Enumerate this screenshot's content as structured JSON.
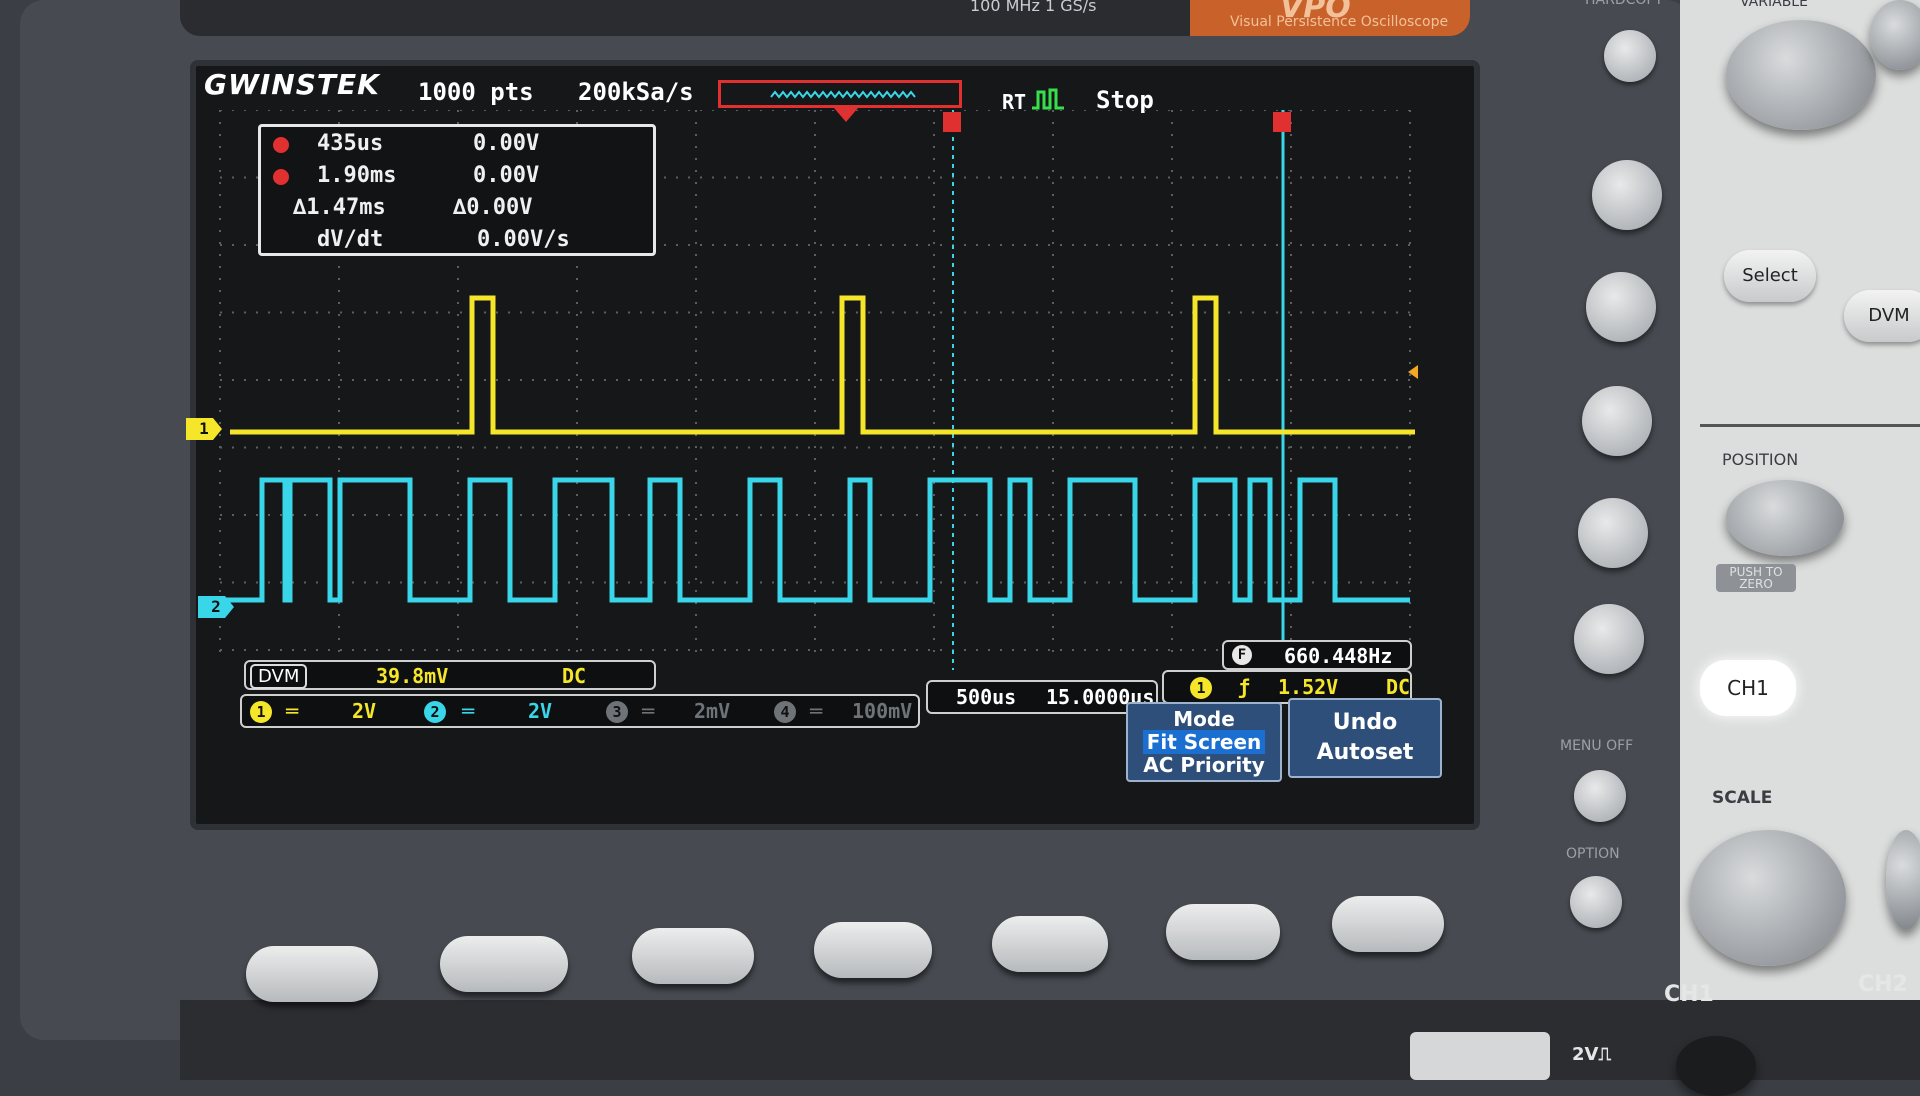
{
  "device_top": {
    "spec_text": "100 MHz  1 GS/s",
    "badge_text": "VPO",
    "subtitle": "Visual Persistence Oscilloscope",
    "hardcopy_label": "HARDCOPY",
    "variable_label": "VARIABLE"
  },
  "header": {
    "brand": "GWINSTEK",
    "record_length": "1000 pts",
    "sample_rate": "200kSa/s",
    "acq_mode": "RT",
    "run_state": "Stop"
  },
  "cursor_readout": {
    "c1_time": "435us",
    "c1_volt": "0.00V",
    "c2_time": "1.90ms",
    "c2_volt": "0.00V",
    "delta_time": "∆1.47ms",
    "delta_volt": "∆0.00V",
    "dvdt_label": "dV/dt",
    "dvdt_value": "0.00V/s",
    "c1_marker": "1",
    "c2_marker": "2"
  },
  "markers": {
    "ch1": "1",
    "ch2": "2"
  },
  "frequency": {
    "label": "F",
    "value": "660.448Hz"
  },
  "dvm": {
    "label": "DVM",
    "value": "39.8mV",
    "coupling": "DC"
  },
  "channels": [
    {
      "num": "1",
      "coupling_symbol": "═",
      "scale": "2V",
      "color": "#f5e62a"
    },
    {
      "num": "2",
      "coupling_symbol": "═",
      "scale": "2V",
      "color": "#39d5e8"
    },
    {
      "num": "3",
      "coupling_symbol": "═",
      "scale": "2mV",
      "color": "#6e7378"
    },
    {
      "num": "4",
      "coupling_symbol": "═",
      "scale": "100mV",
      "color": "#6e7378"
    }
  ],
  "timebase": {
    "scale": "500us",
    "position": "15.0000us"
  },
  "trigger": {
    "source": "1",
    "slope_symbol": "ƒ",
    "level": "1.52V",
    "coupling": "DC"
  },
  "softkey_menu": {
    "mode_title": "Mode",
    "mode_selected": "Fit Screen",
    "mode_option": "AC Priority",
    "undo_line1": "Undo",
    "undo_line2": "Autoset"
  },
  "panel": {
    "select_label": "Select",
    "dvm_label": "DVM",
    "position_label": "POSITION",
    "push_to_zero": "PUSH TO ZERO",
    "ch1_button": "CH1",
    "scale_label": "SCALE",
    "menu_off_label": "MENU OFF",
    "option_label": "OPTION",
    "ch1_bottom": "CH1",
    "ch2_bottom": "CH2",
    "probe_label": "2V⎍"
  },
  "colors": {
    "ch1": "#f5e62a",
    "ch2": "#39d5e8",
    "cursor_line": "#39d5e8",
    "cursor_marker": "#e03030"
  }
}
